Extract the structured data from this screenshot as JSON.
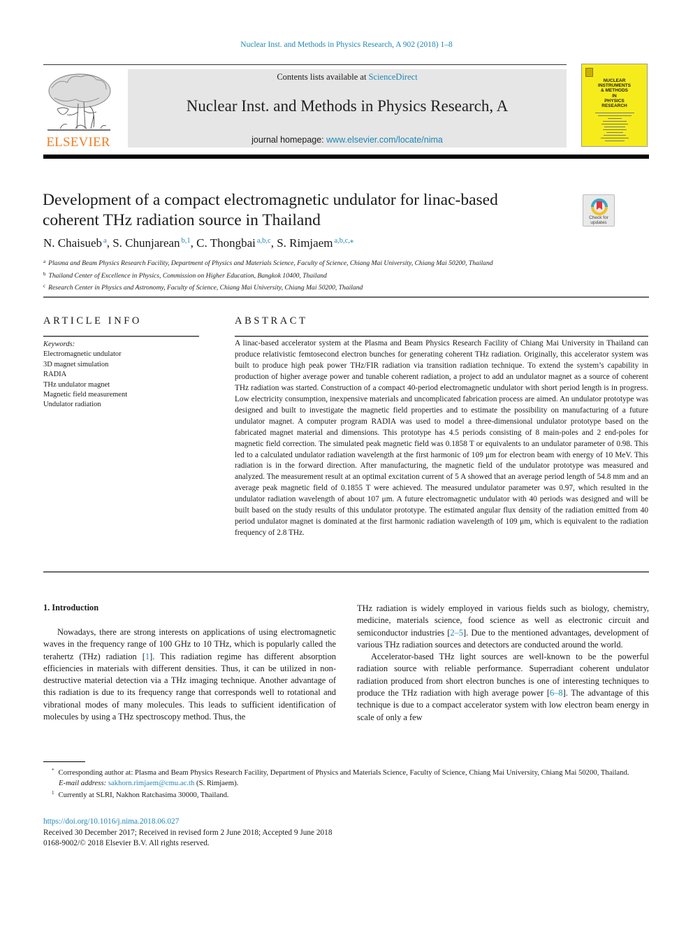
{
  "running_header": "Nuclear Inst. and Methods in Physics Research, A 902 (2018) 1–8",
  "masthead": {
    "publisher_wordmark": "ELSEVIER",
    "contents_prefix": "Contents lists available at ",
    "contents_link": "ScienceDirect",
    "journal_name": "Nuclear Inst. and Methods in Physics Research, A",
    "homepage_prefix": "journal homepage: ",
    "homepage_link": "www.elsevier.com/locate/nima",
    "cover_title": [
      "NUCLEAR",
      "INSTRUMENTS",
      "& METHODS",
      "IN",
      "PHYSICS",
      "RESEARCH"
    ],
    "brand_colors": {
      "elsevier_orange": "#f07e26",
      "link_blue": "#1f87b4",
      "cover_yellow": "#f7ec1b"
    }
  },
  "article": {
    "title_line1": "Development of a compact electromagnetic undulator for linac-based",
    "title_line2": "coherent THz radiation source in Thailand",
    "crossmark": {
      "label_line1": "Check for",
      "label_line2": "updates",
      "icon": "crossmark-icon"
    },
    "authors": [
      {
        "name": "N. Chaisueb",
        "sup": "a"
      },
      {
        "name": "S. Chunjarean",
        "sup": "b,1"
      },
      {
        "name": "C. Thongbai",
        "sup": "a,b,c"
      },
      {
        "name": "S. Rimjaem",
        "sup": "a,b,c,⁎"
      }
    ],
    "author_separator": ", ",
    "affiliations": [
      {
        "key": "a",
        "text": "Plasma and Beam Physics Research Facility, Department of Physics and Materials Science, Faculty of Science, Chiang Mai University, Chiang Mai 50200, Thailand"
      },
      {
        "key": "b",
        "text": "Thailand Center of Excellence in Physics, Commission on Higher Education, Bangkok 10400, Thailand"
      },
      {
        "key": "c",
        "text": "Research Center in Physics and Astronomy, Faculty of Science, Chiang Mai University, Chiang Mai 50200, Thailand"
      }
    ]
  },
  "article_info": {
    "heading": "ARTICLE INFO",
    "keywords_label": "Keywords:",
    "keywords": [
      "Electromagnetic undulator",
      "3D magnet simulation",
      "RADIA",
      "THz undulator magnet",
      "Magnetic field measurement",
      "Undulator radiation"
    ]
  },
  "abstract": {
    "heading": "ABSTRACT",
    "text": "A linac-based accelerator system at the Plasma and Beam Physics Research Facility of Chiang Mai University in Thailand can produce relativistic femtosecond electron bunches for generating coherent THz radiation. Originally, this accelerator system was built to produce high peak power THz/FIR radiation via transition radiation technique. To extend the system’s capability in production of higher average power and tunable coherent radiation, a project to add an undulator magnet as a source of coherent THz radiation was started. Construction of a compact 40-period electromagnetic undulator with short period length is in progress. Low electricity consumption, inexpensive materials and uncomplicated fabrication process are aimed. An undulator prototype was designed and built to investigate the magnetic field properties and to estimate the possibility on manufacturing of a future undulator magnet. A computer program RADIA was used to model a three-dimensional undulator prototype based on the fabricated magnet material and dimensions. This prototype has 4.5 periods consisting of 8 main-poles and 2 end-poles for magnetic field correction. The simulated peak magnetic field was 0.1858 T or equivalents to an undulator parameter of 0.98. This led to a calculated undulator radiation wavelength at the first harmonic of 109 μm for electron beam with energy of 10 MeV. This radiation is in the forward direction. After manufacturing, the magnetic field of the undulator prototype was measured and analyzed. The measurement result at an optimal excitation current of 5 A showed that an average period length of 54.8 mm and an average peak magnetic field of 0.1855 T were achieved. The measured undulator parameter was 0.97, which resulted in the undulator radiation wavelength of about 107 μm. A future electromagnetic undulator with 40 periods was designed and will be built based on the study results of this undulator prototype. The estimated angular flux density of the radiation emitted from 40 period undulator magnet is dominated at the first harmonic radiation wavelength of 109 μm, which is equivalent to the radiation frequency of 2.8 THz."
  },
  "body": {
    "section_heading": "1.  Introduction",
    "left_p1_before": "Nowadays, there are strong interests on applications of using electromagnetic waves in the frequency range of 100 GHz to 10 THz, which is popularly called the terahertz (THz) radiation [",
    "left_p1_ref": "1",
    "left_p1_after": "]. This radiation regime has different absorption efficiencies in materials with different densities. Thus, it can be utilized in non-destructive material detection via a THz imaging technique. Another advantage of this radiation is due to its frequency range that corresponds well to rotational and vibrational modes of many molecules. This leads to sufficient identification of molecules by using a THz spectroscopy method. Thus, the",
    "right_p1_before": "THz radiation is widely employed in various fields such as biology, chemistry, medicine, materials science, food science as well as electronic circuit and semiconductor industries [",
    "right_p1_ref": "2–5",
    "right_p1_after": "]. Due to the mentioned advantages, development of various THz radiation sources and detectors are conducted around the world.",
    "right_p2_before": "Accelerator-based THz light sources are well-known to be the powerful radiation source with reliable performance. Superradiant coherent undulator radiation produced from short electron bunches is one of interesting techniques to produce the THz radiation with high average power [",
    "right_p2_ref": "6–8",
    "right_p2_after": "]. The advantage of this technique is due to a compact accelerator system with low electron beam energy in scale of only a few"
  },
  "footnotes": {
    "corresponding_mark": "*",
    "corresponding_text": "Corresponding author at: Plasma and Beam Physics Research Facility, Department of Physics and Materials Science, Faculty of Science, Chiang Mai University, Chiang Mai 50200, Thailand.",
    "email_label": "E-mail address: ",
    "email": "sakhorn.rimjaem@cmu.ac.th",
    "email_suffix": " (S. Rimjaem).",
    "note1_mark": "1",
    "note1_text": "Currently at SLRI, Nakhon Ratchasima 30000, Thailand."
  },
  "publication": {
    "doi": "https://doi.org/10.1016/j.nima.2018.06.027",
    "history": "Received 30 December 2017; Received in revised form 2 June 2018; Accepted 9 June 2018",
    "copyright": "0168-9002/© 2018 Elsevier B.V. All rights reserved."
  }
}
